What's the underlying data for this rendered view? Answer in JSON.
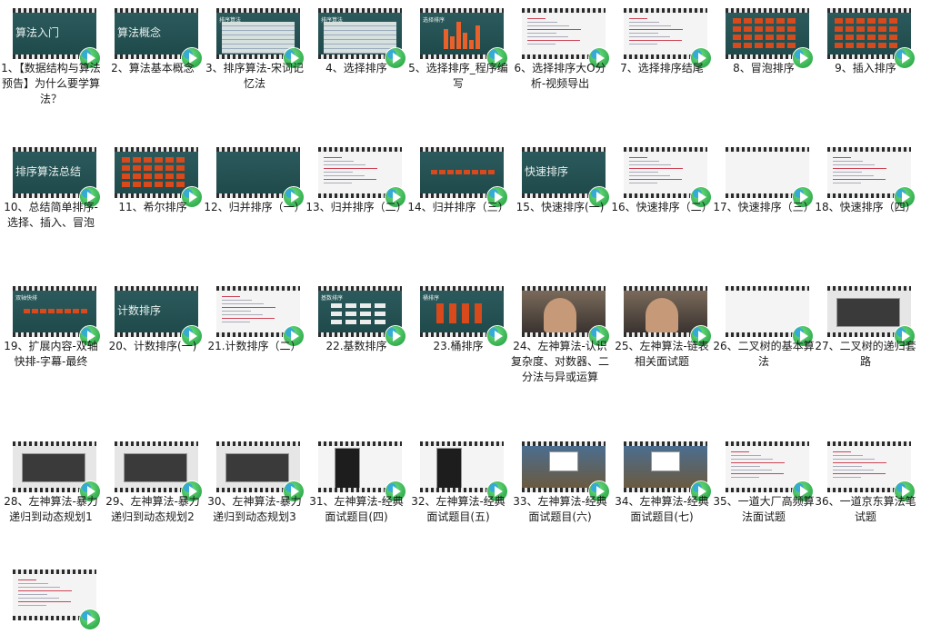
{
  "items": [
    {
      "label": "1、【数据结构与算法预告】为什么要学算法？",
      "thumb": "green",
      "title": "算法入门"
    },
    {
      "label": "2、算法基本概念",
      "thumb": "green",
      "title": "算法概念"
    },
    {
      "label": "3、排序算法-宋词记忆法",
      "thumb": "table",
      "title": "排序算法"
    },
    {
      "label": "4、选择排序",
      "thumb": "table",
      "title": "排序算法"
    },
    {
      "label": "5、选择排序_程序编写",
      "thumb": "bars",
      "title": "选择排序"
    },
    {
      "label": "6、选择排序大O分析-视频导出",
      "thumb": "code",
      "title": ""
    },
    {
      "label": "7、选择排序结尾",
      "thumb": "code",
      "title": ""
    },
    {
      "label": "8、冒泡排序",
      "thumb": "grid",
      "title": ""
    },
    {
      "label": "9、插入排序",
      "thumb": "grid",
      "title": ""
    },
    {
      "label": "10、总结简单排序-选择、插入、冒泡",
      "thumb": "green",
      "title": "排序算法总结"
    },
    {
      "label": "11、希尔排序",
      "thumb": "grid",
      "title": ""
    },
    {
      "label": "12、归并排序（一）",
      "thumb": "green",
      "title": ""
    },
    {
      "label": "13、归并排序（二）",
      "thumb": "code",
      "title": ""
    },
    {
      "label": "14、归并排序（三）",
      "thumb": "rowboxes",
      "title": ""
    },
    {
      "label": "15、快速排序(一)",
      "thumb": "green",
      "title": "快速排序"
    },
    {
      "label": "16、快速排序（二）",
      "thumb": "code",
      "title": ""
    },
    {
      "label": "17、快速排序（三）",
      "thumb": "white",
      "title": ""
    },
    {
      "label": "18、快速排序（四）",
      "thumb": "code",
      "title": ""
    },
    {
      "label": "19、扩展内容-双轴快排-字幕-最终",
      "thumb": "rowboxes",
      "title": "双轴快排"
    },
    {
      "label": "20、计数排序(一)",
      "thumb": "green",
      "title": "计数排序"
    },
    {
      "label": "21.计数排序（二）",
      "thumb": "code",
      "title": ""
    },
    {
      "label": "22.基数排序",
      "thumb": "radix",
      "title": "基数排序"
    },
    {
      "label": "23.桶排序",
      "thumb": "bucket",
      "title": "桶排序"
    },
    {
      "label": "24、左神算法-认识复杂度、对数器、二分法与异或运算",
      "thumb": "face",
      "title": ""
    },
    {
      "label": "25、左神算法-链表相关面试题",
      "thumb": "face",
      "title": ""
    },
    {
      "label": "26、二叉树的基本算法",
      "thumb": "white",
      "title": ""
    },
    {
      "label": "27、二叉树的递归套路",
      "thumb": "dialog",
      "title": ""
    },
    {
      "label": "28、左神算法-暴力递归到动态规划1",
      "thumb": "dialog",
      "title": ""
    },
    {
      "label": "29、左神算法-暴力递归到动态规划2",
      "thumb": "dialog",
      "title": ""
    },
    {
      "label": "30、左神算法-暴力递归到动态规划3",
      "thumb": "dialog",
      "title": ""
    },
    {
      "label": "31、左神算法-经典面试题目(四)",
      "thumb": "dark",
      "title": ""
    },
    {
      "label": "32、左神算法-经典面试题目(五)",
      "thumb": "dark",
      "title": ""
    },
    {
      "label": "33、左神算法-经典面试题目(六)",
      "thumb": "desk",
      "title": ""
    },
    {
      "label": "34、左神算法-经典面试题目(七)",
      "thumb": "desk",
      "title": ""
    },
    {
      "label": "35、一道大厂高频算法面试题",
      "thumb": "hand",
      "title": ""
    },
    {
      "label": "36、一道京东算法笔试题",
      "thumb": "code",
      "title": ""
    },
    {
      "label": "",
      "thumb": "code",
      "title": ""
    }
  ]
}
